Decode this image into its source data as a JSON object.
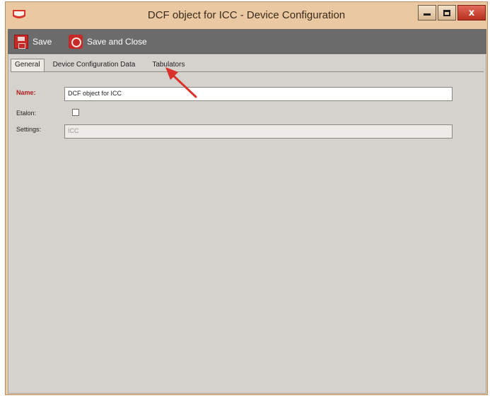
{
  "window": {
    "title": "DCF object for ICC - Device Configuration",
    "colors": {
      "frame": "#e9c8a2",
      "toolbar": "#6b6b6b",
      "content": "#d5d2cd",
      "accent": "#c72a26"
    }
  },
  "toolbar": {
    "save_label": "Save",
    "save_close_label": "Save and Close",
    "save_icon": "save-icon",
    "save_close_icon": "save-close-icon"
  },
  "tabs": [
    {
      "label": "General",
      "active": true
    },
    {
      "label": "Device Configuration Data",
      "active": false
    },
    {
      "label": "Tabulators",
      "active": false
    }
  ],
  "form": {
    "name_label": "Name:",
    "name_value": "DCF object for ICC",
    "etalon_label": "Etalon:",
    "etalon_checked": false,
    "settings_label": "Settings:",
    "settings_value": "ICC"
  },
  "annotation": {
    "arrow_color": "#d9322b"
  }
}
